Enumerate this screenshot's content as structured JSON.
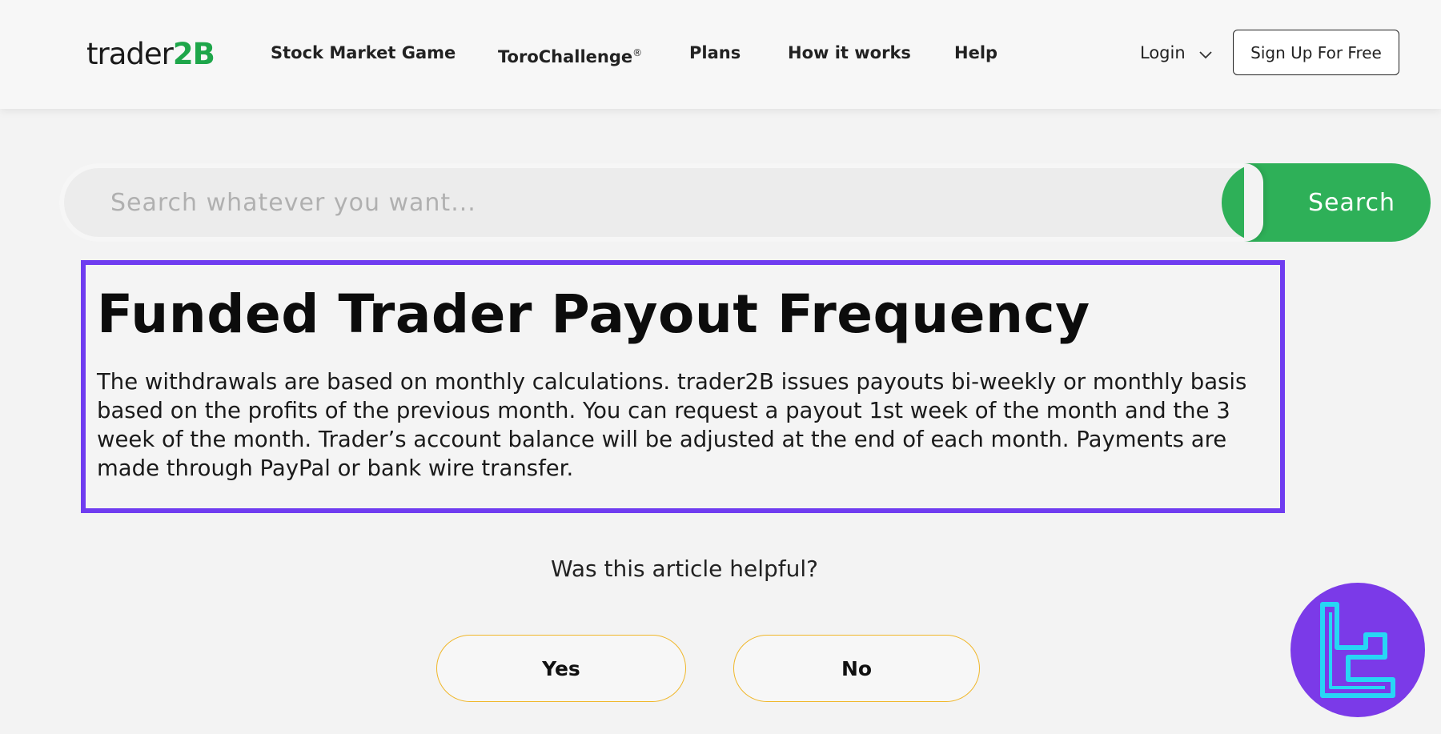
{
  "header": {
    "logo_text": "trader",
    "logo_accent": "2B",
    "nav": [
      {
        "label": "Stock Market Game"
      },
      {
        "label": "ToroChallenge",
        "sup": "®"
      },
      {
        "label": "Plans"
      },
      {
        "label": "How it works"
      },
      {
        "label": "Help"
      }
    ],
    "login_label": "Login",
    "signup_label": "Sign Up For Free"
  },
  "search": {
    "placeholder": "Search whatever you want...",
    "button_label": "Search"
  },
  "article": {
    "title": "Funded Trader Payout Frequency",
    "body": "The withdrawals are based on monthly calculations. trader2B issues payouts bi-weekly or monthly basis based on the profits of the previous month. You can request a payout 1st week of the month and the 3 week of the month. Trader’s account balance will be adjusted at the end of each month. Payments are made through PayPal or bank wire transfer."
  },
  "feedback": {
    "question": "Was this article helpful?",
    "yes_label": "Yes",
    "no_label": "No"
  },
  "colors": {
    "brand_green": "#2eb058",
    "highlight_border": "#6f3cf0",
    "vote_border": "#f0b72a",
    "badge_bg": "#7b3ae8",
    "badge_icon": "#27d6f5"
  },
  "icons": {
    "login_chevron": "chevron-down-icon",
    "badge": "tradingfinder-logo-icon"
  }
}
